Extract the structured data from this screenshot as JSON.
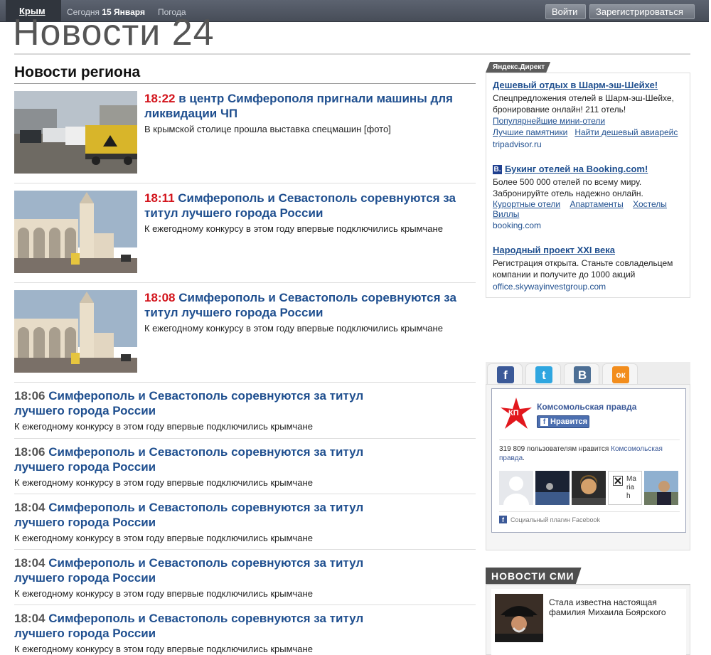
{
  "topbar": {
    "region": "Крым",
    "today_label": "Сегодня",
    "today_date": "15 Января",
    "weather": "Погода",
    "login": "Войти",
    "register": "Зарегистрироваться"
  },
  "logo": "Новости 24",
  "section_title": "Новости региона",
  "news": [
    {
      "time": "18:22",
      "title": "в центр Симферополя пригнали машины для ликвидации ЧП",
      "lead": "В крымской столице прошла выставка спецмашин [фото]"
    },
    {
      "time": "18:11",
      "title": "Симферополь и Севастополь соревнуются за титул лучшего города России",
      "lead": "К ежегодному конкурсу в этом году впервые подключились крымчане"
    },
    {
      "time": "18:08",
      "title": "Симферополь и Севастополь соревнуются за титул лучшего города России",
      "lead": "К ежегодному конкурсу в этом году впервые подключились крымчане"
    },
    {
      "time": "18:06",
      "title_l1": "Симферополь и Севастополь соревнуются за титул",
      "title_l2": "лучшего города России",
      "lead": "К ежегодному конкурсу в этом году впервые подключились крымчане"
    },
    {
      "time": "18:06",
      "title_l1": "Симферополь и Севастополь соревнуются за титул",
      "title_l2": "лучшего города России",
      "lead": "К ежегодному конкурсу в этом году впервые подключились крымчане"
    },
    {
      "time": "18:04",
      "title_l1": "Симферополь и Севастополь соревнуются за титул",
      "title_l2": "лучшего города России",
      "lead": "К ежегодному конкурсу в этом году впервые подключились крымчане"
    },
    {
      "time": "18:04",
      "title_l1": "Симферополь и Севастополь соревнуются за титул",
      "title_l2": "лучшего города России",
      "lead": "К ежегодному конкурсу в этом году впервые подключились крымчане"
    },
    {
      "time": "18:04",
      "title_l1": "Симферополь и Севастополь соревнуются за титул",
      "title_l2": "лучшего города России",
      "lead": "К ежегодному конкурсу в этом году впервые подключились крымчане"
    }
  ],
  "direct": {
    "label": "Яндекс.Директ",
    "ads": [
      {
        "title": "Дешевый отдых в Шарм-эш-Шейхе!",
        "text": "Спецпредложения отелей в Шарм-эш-Шейхе, бронирование онлайн! 211 отель!",
        "links": [
          "Популярнейшие мини-отели",
          "Лучшие памятники",
          "Найти дешевый авиарейс"
        ],
        "url": "tripadvisor.ru"
      },
      {
        "logo": "B.",
        "title": "Букинг отелей на Booking.com!",
        "text": "Более 500 000 отелей по всему миру. Забронируйте отель надежно онлайн.",
        "links": [
          "Курортные отели",
          "Апартаменты",
          "Хостелы",
          "Виллы"
        ],
        "url": "booking.com"
      },
      {
        "title": "Народный проект XXI века",
        "text": "Регистрация открыта. Станьте совладельцем компании и получите до 1000 акций",
        "url": "office.skywayinvestgroup.com"
      }
    ]
  },
  "social": {
    "tabs": [
      {
        "icon": "facebook-icon",
        "glyph": "f",
        "color": "#3b5998"
      },
      {
        "icon": "twitter-icon",
        "glyph": "t",
        "color": "#2fa6e0"
      },
      {
        "icon": "vkontakte-icon",
        "glyph": "B",
        "color": "#4d6f95"
      },
      {
        "icon": "odnoklassniki-icon",
        "glyph": "ок",
        "color": "#f28d1d"
      }
    ],
    "page_name": "Комсомольская правда",
    "logo_text": "КП",
    "like": "Нравится",
    "count_text": "319 809 пользователям нравится",
    "count_link": "Комсомольская правда",
    "count_end": ".",
    "face_name": "Mariah",
    "plugin": "Социальный плагин Facebook"
  },
  "smi": {
    "header": "НОВОСТИ СМИ",
    "item": "Стала известна настоящая фамилия Михаила Боярского"
  }
}
